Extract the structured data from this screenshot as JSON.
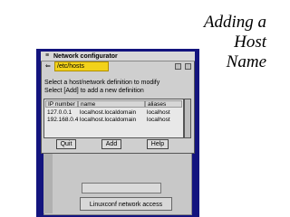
{
  "slide": {
    "title_lines": [
      "Adding a",
      "Host",
      "Name"
    ]
  },
  "window": {
    "title": "Network configurator",
    "path": "/etc/hosts",
    "background_button": "Linuxconf network access"
  },
  "instructions": {
    "line1": "Select a host/network definition to modify",
    "line2": "Select [Add] to add a new definition"
  },
  "table": {
    "columns": [
      "IP number",
      "name",
      "aliases"
    ],
    "rows": [
      [
        "127.0.0.1",
        "localhost.localdomain",
        "localhost"
      ],
      [
        "192.168.0.4",
        "localhost.localdomain",
        "localhost"
      ]
    ]
  },
  "buttons": {
    "quit": "Quit",
    "add": "Add",
    "help": "Help"
  },
  "colors": {
    "background_window": "#13147e",
    "path_highlight": "#f2d21a"
  }
}
